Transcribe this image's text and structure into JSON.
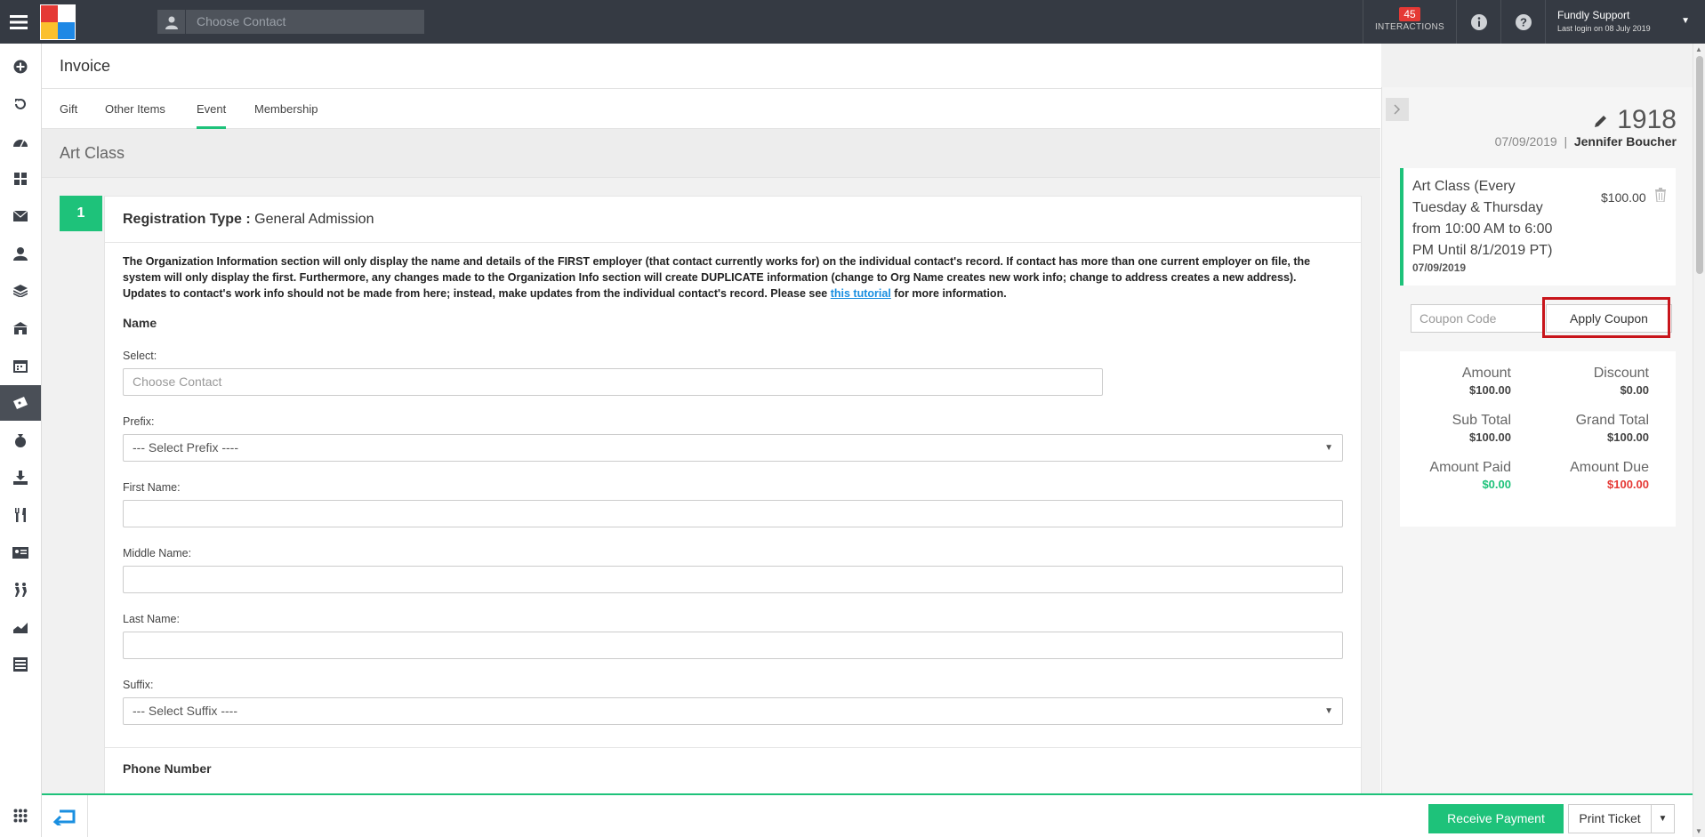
{
  "topbar": {
    "search_placeholder": "Choose Contact",
    "interactions_count": "45",
    "interactions_label": "INTERACTIONS",
    "user_name": "Fundly Support",
    "last_login": "Last login on 08 July 2019"
  },
  "page": {
    "title": "Invoice",
    "tabs": [
      "Gift",
      "Other Items",
      "Event",
      "Membership"
    ],
    "active_tab": "Event"
  },
  "section": {
    "title": "Art Class",
    "step": "1",
    "reg_type_label": "Registration Type :",
    "reg_type_value": "General Admission",
    "notice_text": "The Organization Information section will only display the name and details of the FIRST employer (that contact currently works for) on the individual contact's record. If contact has more than one current employer on file, the system will only display the first. Furthermore, any changes made to the Organization Info section will create DUPLICATE information (change to Org Name creates new work info; change to address creates a new address). Updates to contact's work info should not be made from here; instead, make updates from the individual contact's record. Please see",
    "notice_link": "this tutorial",
    "notice_tail": "for more information."
  },
  "form": {
    "name_heading": "Name",
    "select_label": "Select:",
    "select_placeholder": "Choose Contact",
    "prefix_label": "Prefix:",
    "prefix_value": "--- Select Prefix ----",
    "first_label": "First Name:",
    "middle_label": "Middle Name:",
    "last_label": "Last Name:",
    "suffix_label": "Suffix:",
    "suffix_value": "--- Select Suffix ----",
    "phone_heading": "Phone Number"
  },
  "invoice_panel": {
    "number": "1918",
    "date": "07/09/2019",
    "separator": "|",
    "contact": "Jennifer Boucher",
    "item_desc": "Art Class (Every Tuesday & Thursday from 10:00 AM to 6:00 PM Until 8/1/2019 PT)",
    "item_date": "07/09/2019",
    "item_price": "$100.00",
    "coupon_placeholder": "Coupon Code",
    "apply_label": "Apply Coupon",
    "amount_label": "Amount",
    "amount_value": "$100.00",
    "discount_label": "Discount",
    "discount_value": "$0.00",
    "subtotal_label": "Sub Total",
    "subtotal_value": "$100.00",
    "grandtotal_label": "Grand Total",
    "grandtotal_value": "$100.00",
    "paid_label": "Amount Paid",
    "paid_value": "$0.00",
    "due_label": "Amount Due",
    "due_value": "$100.00",
    "paid_color": "#1ec27a",
    "due_color": "#e53935"
  },
  "bottom": {
    "receive_payment": "Receive Payment",
    "print_ticket": "Print Ticket"
  },
  "colors": {
    "accent": "#1ec27a",
    "topbar": "#353a43",
    "highlight": "#c8151b"
  }
}
